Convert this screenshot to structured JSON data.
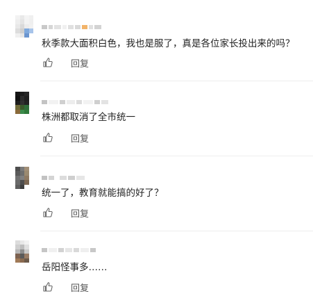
{
  "comments": [
    {
      "text": "秋季款大面积白色，我也是服了，真是各位家长投出来的吗？",
      "like_icon": "thumbs-up-icon",
      "reply_label": "回复"
    },
    {
      "text": "株洲都取消了全市统一",
      "like_icon": "thumbs-up-icon",
      "reply_label": "回复"
    },
    {
      "text": "统一了，教育就能搞的好了？",
      "like_icon": "thumbs-up-icon",
      "reply_label": "回复"
    },
    {
      "text": "岳阳怪事多……",
      "like_icon": "thumbs-up-icon",
      "reply_label": "回复"
    }
  ]
}
